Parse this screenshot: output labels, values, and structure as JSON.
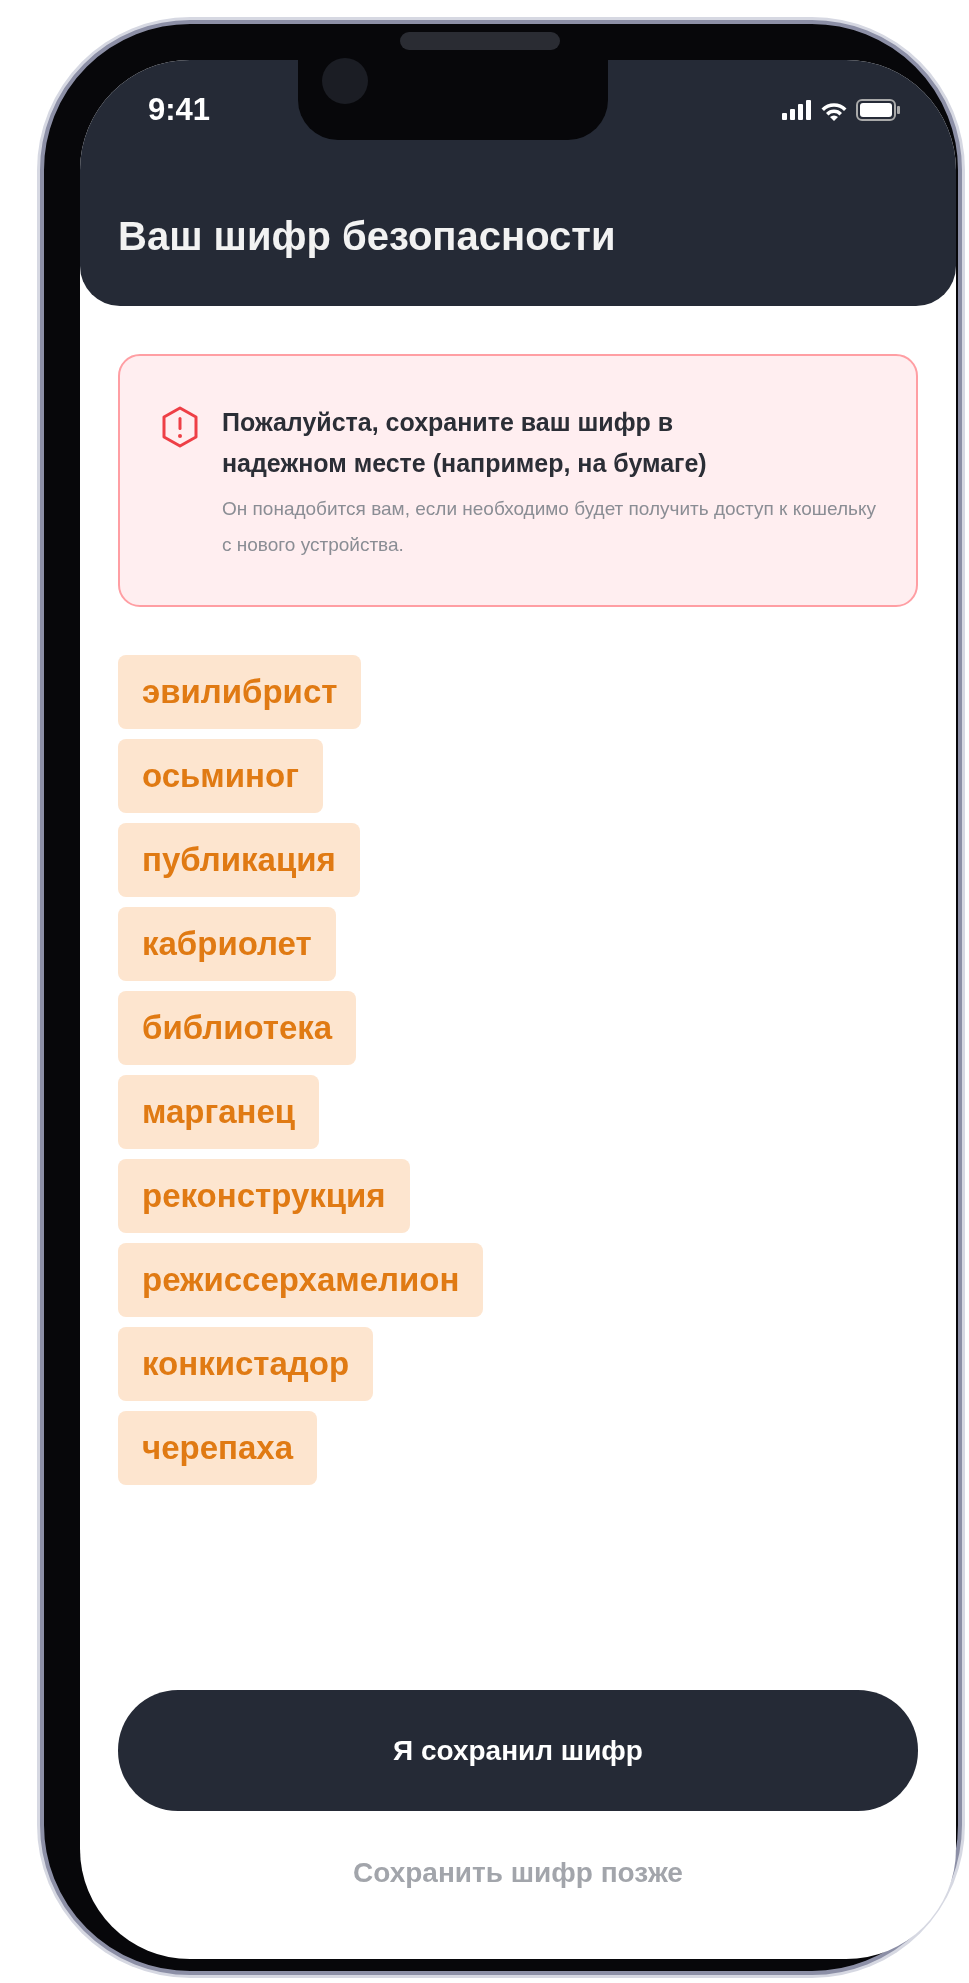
{
  "status_bar": {
    "time": "9:41"
  },
  "header": {
    "title": "Ваш шифр безопасности"
  },
  "warning": {
    "title": "Пожалуйста, сохраните ваш шифр в надежном месте (например, на бумаге)",
    "text": "Он понадобится вам, если необходимо будет получить доступ к кошельку с нового устройства."
  },
  "words": [
    "эвилибрист",
    "осьминог",
    "публикация",
    "кабриолет",
    "библиотека",
    "марганец",
    "реконструкция",
    "режиссерхамелион",
    "конкистадор",
    "черепаха"
  ],
  "primary_button": "Я сохранил шифр",
  "secondary_button": "Сохранить шифр позже"
}
